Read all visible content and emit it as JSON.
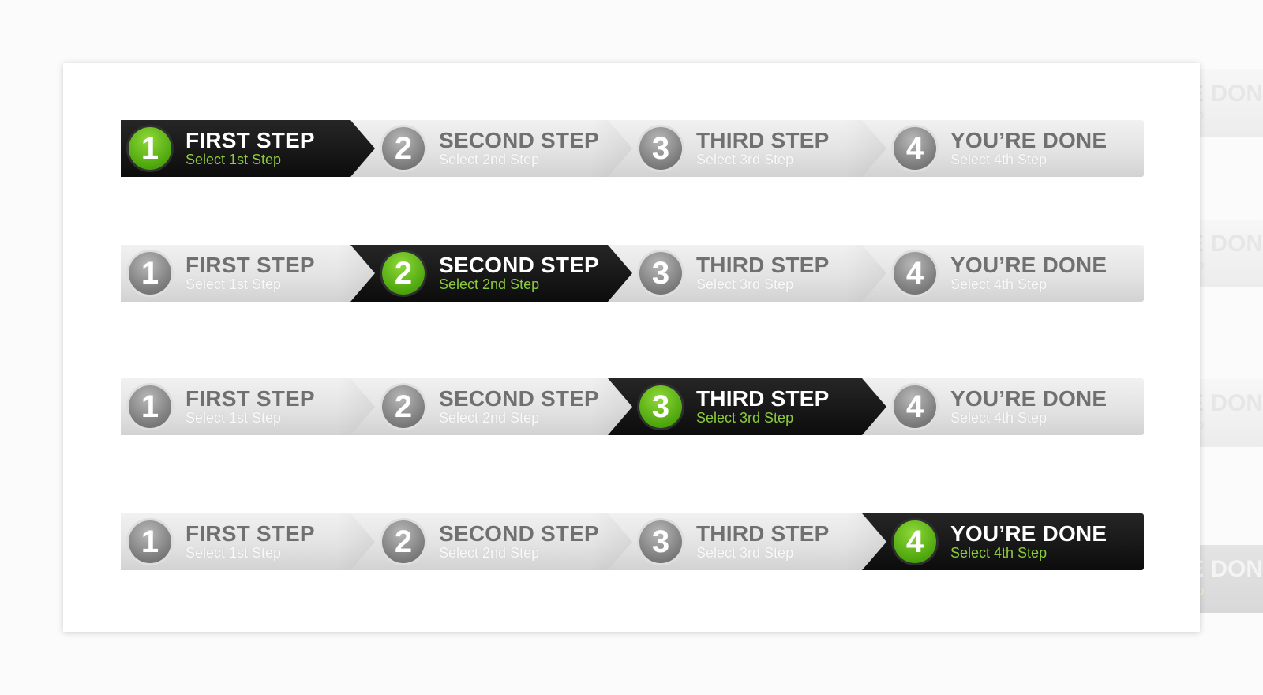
{
  "steps": [
    {
      "number": "1",
      "title": "FIRST STEP",
      "subtitle": "Select 1st Step"
    },
    {
      "number": "2",
      "title": "SECOND STEP",
      "subtitle": "Select 2nd Step"
    },
    {
      "number": "3",
      "title": "THIRD STEP",
      "subtitle": "Select 3rd Step"
    },
    {
      "number": "4",
      "title": "YOU’RE DONE",
      "subtitle": "Select 4th Step"
    }
  ],
  "bars": [
    {
      "active_step": 1
    },
    {
      "active_step": 2
    },
    {
      "active_step": 3
    },
    {
      "active_step": 4
    }
  ],
  "colors": {
    "active_bg": "#111111",
    "inactive_bg": "#e3e3e3",
    "accent_green": "#5cb91a",
    "active_subtitle": "#8ccc3a",
    "inactive_title": "#707070"
  }
}
